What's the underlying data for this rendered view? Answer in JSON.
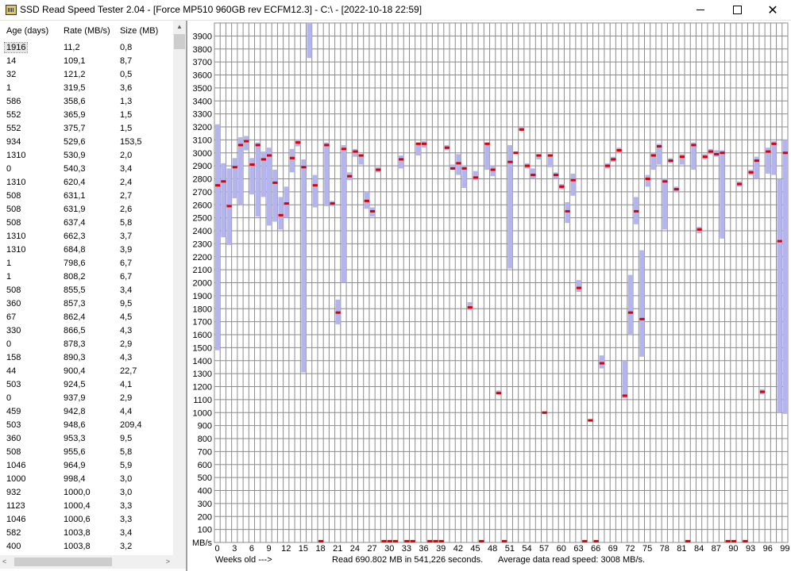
{
  "window": {
    "title": "SSD Read Speed Tester 2.04 - [Force MP510 960GB rev ECFM12.3] - C:\\ - [2022-10-18 22:59]",
    "controls": [
      "minimize",
      "maximize",
      "close"
    ],
    "close_glyph": "✕"
  },
  "table": {
    "columns": [
      "Age (days)",
      "Rate (MB/s)",
      "Size (MB)"
    ],
    "selected_row": 0,
    "rows": [
      [
        "1916",
        "11,2",
        "0,8"
      ],
      [
        "14",
        "109,1",
        "8,7"
      ],
      [
        "32",
        "121,2",
        "0,5"
      ],
      [
        "1",
        "319,5",
        "3,6"
      ],
      [
        "586",
        "358,6",
        "1,3"
      ],
      [
        "552",
        "365,9",
        "1,5"
      ],
      [
        "552",
        "375,7",
        "1,5"
      ],
      [
        "934",
        "529,6",
        "153,5"
      ],
      [
        "1310",
        "530,9",
        "2,0"
      ],
      [
        "0",
        "540,3",
        "3,4"
      ],
      [
        "1310",
        "620,4",
        "2,4"
      ],
      [
        "508",
        "631,1",
        "2,7"
      ],
      [
        "508",
        "631,9",
        "2,6"
      ],
      [
        "508",
        "637,4",
        "5,8"
      ],
      [
        "1310",
        "662,3",
        "3,7"
      ],
      [
        "1310",
        "684,8",
        "3,9"
      ],
      [
        "1",
        "798,6",
        "6,7"
      ],
      [
        "1",
        "808,2",
        "6,7"
      ],
      [
        "508",
        "855,5",
        "3,4"
      ],
      [
        "360",
        "857,3",
        "9,5"
      ],
      [
        "67",
        "862,4",
        "4,5"
      ],
      [
        "330",
        "866,5",
        "4,3"
      ],
      [
        "0",
        "878,3",
        "2,9"
      ],
      [
        "158",
        "890,3",
        "4,3"
      ],
      [
        "44",
        "900,4",
        "22,7"
      ],
      [
        "503",
        "924,5",
        "4,1"
      ],
      [
        "0",
        "937,9",
        "2,9"
      ],
      [
        "459",
        "942,8",
        "4,4"
      ],
      [
        "503",
        "948,6",
        "209,4"
      ],
      [
        "360",
        "953,3",
        "9,5"
      ],
      [
        "508",
        "955,6",
        "5,8"
      ],
      [
        "1046",
        "964,9",
        "5,9"
      ],
      [
        "1000",
        "998,4",
        "3,0"
      ],
      [
        "932",
        "1000,0",
        "3,0"
      ],
      [
        "1123",
        "1000,4",
        "3,3"
      ],
      [
        "1046",
        "1000,6",
        "3,3"
      ],
      [
        "582",
        "1003,8",
        "3,4"
      ],
      [
        "400",
        "1003,8",
        "3,2"
      ]
    ]
  },
  "scrollbars": {
    "up_arrow": "▲",
    "left_arrow": "<",
    "right_arrow": ">"
  },
  "footer": {
    "weeks_label": "Weeks old --->",
    "read_summary": "Read 690.802 MB in 541,226 seconds.",
    "average": "Average data read speed: 3008 MB/s."
  },
  "colors": {
    "grid": "#8c8c8c",
    "range_bar": "#b4b4ee",
    "avg_marker": "#dd0000"
  },
  "chart_data": {
    "type": "range-bar",
    "xlabel": "Weeks old --->",
    "ylabel": "MB/s",
    "ylim": [
      0,
      4000
    ],
    "y_ticks": [
      100,
      200,
      300,
      400,
      500,
      600,
      700,
      800,
      900,
      1000,
      1100,
      1200,
      1300,
      1400,
      1500,
      1600,
      1700,
      1800,
      1900,
      2000,
      2100,
      2200,
      2300,
      2400,
      2500,
      2600,
      2700,
      2800,
      2900,
      3000,
      3100,
      3200,
      3300,
      3400,
      3500,
      3600,
      3700,
      3800,
      3900
    ],
    "xlim": [
      0,
      99
    ],
    "x_ticks": [
      0,
      3,
      6,
      9,
      12,
      15,
      18,
      21,
      24,
      27,
      30,
      33,
      36,
      39,
      42,
      45,
      48,
      51,
      54,
      57,
      60,
      63,
      66,
      69,
      72,
      75,
      78,
      81,
      84,
      87,
      90,
      93,
      96,
      99
    ],
    "grid": true,
    "series": [
      {
        "week": 0,
        "min": 1480,
        "max": 3220,
        "avg": 2750
      },
      {
        "week": 1,
        "min": 2350,
        "max": 2920,
        "avg": 2780
      },
      {
        "week": 2,
        "min": 2290,
        "max": 2880,
        "avg": 2590
      },
      {
        "week": 3,
        "min": 2650,
        "max": 2960,
        "avg": 2890
      },
      {
        "week": 4,
        "min": 2600,
        "max": 3120,
        "avg": 3060
      },
      {
        "week": 5,
        "min": 3020,
        "max": 3130,
        "avg": 3090
      },
      {
        "week": 6,
        "min": 2680,
        "max": 2960,
        "avg": 2910
      },
      {
        "week": 7,
        "min": 2510,
        "max": 3080,
        "avg": 3060
      },
      {
        "week": 8,
        "min": 2660,
        "max": 3010,
        "avg": 2950
      },
      {
        "week": 9,
        "min": 2440,
        "max": 3040,
        "avg": 2980
      },
      {
        "week": 10,
        "min": 2470,
        "max": 2870,
        "avg": 2770
      },
      {
        "week": 11,
        "min": 2410,
        "max": 2660,
        "avg": 2520
      },
      {
        "week": 12,
        "min": 2500,
        "max": 2740,
        "avg": 2610
      },
      {
        "week": 13,
        "min": 2850,
        "max": 3030,
        "avg": 2960
      },
      {
        "week": 14,
        "min": 3050,
        "max": 3100,
        "avg": 3080
      },
      {
        "week": 15,
        "min": 1310,
        "max": 2950,
        "avg": 2890
      },
      {
        "week": 16,
        "min": 3730,
        "max": 4000
      },
      {
        "week": 17,
        "min": 2580,
        "max": 2830,
        "avg": 2750
      },
      {
        "week": 18,
        "min": 0,
        "max": 0,
        "avg": 10
      },
      {
        "week": 19,
        "min": 2590,
        "max": 3080,
        "avg": 3060
      },
      {
        "week": 20,
        "min": 2590,
        "max": 2630,
        "avg": 2610
      },
      {
        "week": 21,
        "min": 1680,
        "max": 1870,
        "avg": 1770
      },
      {
        "week": 22,
        "min": 2000,
        "max": 3060,
        "avg": 3030
      },
      {
        "week": 23,
        "min": 2790,
        "max": 2850,
        "avg": 2820
      },
      {
        "week": 24,
        "min": 2970,
        "max": 3030,
        "avg": 3010
      },
      {
        "week": 25,
        "min": 2910,
        "max": 2990,
        "avg": 2980
      },
      {
        "week": 26,
        "min": 2570,
        "max": 2700,
        "avg": 2630
      },
      {
        "week": 27,
        "min": 2510,
        "max": 2580,
        "avg": 2550
      },
      {
        "week": 28,
        "min": 2850,
        "max": 2890,
        "avg": 2870
      },
      {
        "week": 29,
        "min": 0,
        "max": 0,
        "avg": 10
      },
      {
        "week": 30,
        "min": 0,
        "max": 0,
        "avg": 10
      },
      {
        "week": 31,
        "min": 0,
        "max": 0,
        "avg": 10
      },
      {
        "week": 32,
        "min": 2880,
        "max": 2980,
        "avg": 2950
      },
      {
        "week": 33,
        "min": 0,
        "max": 0,
        "avg": 10
      },
      {
        "week": 34,
        "min": 0,
        "max": 0,
        "avg": 10
      },
      {
        "week": 35,
        "min": 2980,
        "max": 3080,
        "avg": 3070
      },
      {
        "week": 36,
        "min": 3040,
        "max": 3090,
        "avg": 3070
      },
      {
        "week": 37,
        "min": 0,
        "max": 0,
        "avg": 10
      },
      {
        "week": 38,
        "min": 0,
        "max": 0,
        "avg": 10
      },
      {
        "week": 39,
        "min": 0,
        "max": 0,
        "avg": 10
      },
      {
        "week": 40,
        "min": 3020,
        "max": 3060,
        "avg": 3040
      },
      {
        "week": 41,
        "min": 2870,
        "max": 2910,
        "avg": 2880
      },
      {
        "week": 42,
        "min": 2830,
        "max": 2990,
        "avg": 2920
      },
      {
        "week": 43,
        "min": 2730,
        "max": 2900,
        "avg": 2880
      },
      {
        "week": 44,
        "min": 1790,
        "max": 1850,
        "avg": 1810
      },
      {
        "week": 45,
        "min": 2790,
        "max": 2860,
        "avg": 2810
      },
      {
        "week": 46,
        "min": 0,
        "max": 0,
        "avg": 10
      },
      {
        "week": 47,
        "min": 2870,
        "max": 3080,
        "avg": 3070
      },
      {
        "week": 48,
        "min": 2820,
        "max": 2900,
        "avg": 2870
      },
      {
        "week": 49,
        "min": 1140,
        "max": 1170,
        "avg": 1150
      },
      {
        "week": 50,
        "min": 0,
        "max": 0,
        "avg": 10
      },
      {
        "week": 51,
        "min": 2110,
        "max": 3060,
        "avg": 2930
      },
      {
        "week": 52,
        "min": 2990,
        "max": 3010,
        "avg": 3000
      },
      {
        "week": 53,
        "min": 3170,
        "max": 3200,
        "avg": 3180
      },
      {
        "week": 54,
        "min": 2880,
        "max": 2920,
        "avg": 2900
      },
      {
        "week": 55,
        "min": 2800,
        "max": 2880,
        "avg": 2830
      },
      {
        "week": 56,
        "min": 2950,
        "max": 2990,
        "avg": 2980
      },
      {
        "week": 57,
        "min": 990,
        "max": 1010,
        "avg": 1000
      },
      {
        "week": 58,
        "min": 2890,
        "max": 2990,
        "avg": 2980
      },
      {
        "week": 59,
        "min": 2800,
        "max": 2850,
        "avg": 2830
      },
      {
        "week": 60,
        "min": 2720,
        "max": 2760,
        "avg": 2740
      },
      {
        "week": 61,
        "min": 2460,
        "max": 2620,
        "avg": 2550
      },
      {
        "week": 62,
        "min": 2670,
        "max": 2840,
        "avg": 2790
      },
      {
        "week": 63,
        "min": 1930,
        "max": 2020,
        "avg": 1960
      },
      {
        "week": 64,
        "min": 0,
        "max": 0,
        "avg": 10
      },
      {
        "week": 65,
        "min": 930,
        "max": 950,
        "avg": 940
      },
      {
        "week": 66,
        "min": 0,
        "max": 0,
        "avg": 10
      },
      {
        "week": 67,
        "min": 1340,
        "max": 1440,
        "avg": 1380
      },
      {
        "week": 68,
        "min": 2880,
        "max": 2920,
        "avg": 2900
      },
      {
        "week": 69,
        "min": 2930,
        "max": 2970,
        "avg": 2950
      },
      {
        "week": 70,
        "min": 3000,
        "max": 3040,
        "avg": 3020
      },
      {
        "week": 71,
        "min": 1110,
        "max": 1400,
        "avg": 1130
      },
      {
        "week": 72,
        "min": 1600,
        "max": 2060,
        "avg": 1770
      },
      {
        "week": 73,
        "min": 2450,
        "max": 2660,
        "avg": 2550
      },
      {
        "week": 74,
        "min": 1430,
        "max": 2250,
        "avg": 1720
      },
      {
        "week": 75,
        "min": 2740,
        "max": 2830,
        "avg": 2800
      },
      {
        "week": 76,
        "min": 2870,
        "max": 3000,
        "avg": 2980
      },
      {
        "week": 77,
        "min": 2910,
        "max": 3070,
        "avg": 3050
      },
      {
        "week": 78,
        "min": 2410,
        "max": 2800,
        "avg": 2780
      },
      {
        "week": 79,
        "min": 2920,
        "max": 2960,
        "avg": 2940
      },
      {
        "week": 80,
        "min": 2700,
        "max": 2740,
        "avg": 2720
      },
      {
        "week": 81,
        "min": 2910,
        "max": 2990,
        "avg": 2970
      },
      {
        "week": 82,
        "min": 0,
        "max": 0,
        "avg": 10
      },
      {
        "week": 83,
        "min": 2870,
        "max": 3080,
        "avg": 3060
      },
      {
        "week": 84,
        "min": 2380,
        "max": 2430,
        "avg": 2410
      },
      {
        "week": 85,
        "min": 2950,
        "max": 2990,
        "avg": 2970
      },
      {
        "week": 86,
        "min": 2990,
        "max": 3030,
        "avg": 3010
      },
      {
        "week": 87,
        "min": 2970,
        "max": 3020,
        "avg": 2990
      },
      {
        "week": 88,
        "min": 2340,
        "max": 3020,
        "avg": 3000
      },
      {
        "week": 89,
        "min": 0,
        "max": 0,
        "avg": 10
      },
      {
        "week": 90,
        "min": 0,
        "max": 0,
        "avg": 10
      },
      {
        "week": 91,
        "min": 2740,
        "max": 2780,
        "avg": 2760
      },
      {
        "week": 92,
        "min": 0,
        "max": 0,
        "avg": 10
      },
      {
        "week": 93,
        "min": 2830,
        "max": 2870,
        "avg": 2850
      },
      {
        "week": 94,
        "min": 2800,
        "max": 2970,
        "avg": 2940
      },
      {
        "week": 95,
        "min": 1140,
        "max": 1180,
        "avg": 1160
      },
      {
        "week": 96,
        "min": 2840,
        "max": 3040,
        "avg": 3010
      },
      {
        "week": 97,
        "min": 2830,
        "max": 3090,
        "avg": 3070
      },
      {
        "week": 98,
        "min": 1000,
        "max": 2800,
        "avg": 2320
      },
      {
        "week": 99,
        "min": 990,
        "max": 3100,
        "avg": 3000
      }
    ]
  }
}
